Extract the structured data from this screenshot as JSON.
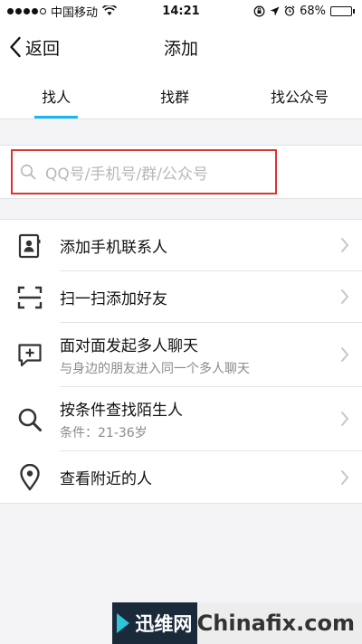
{
  "status_bar": {
    "carrier": "中国移动",
    "time": "14:21",
    "battery": "68%",
    "battery_level": 0.68
  },
  "nav": {
    "back_label": "返回",
    "title": "添加"
  },
  "tabs": [
    {
      "label": "找人",
      "active": true
    },
    {
      "label": "找群",
      "active": false
    },
    {
      "label": "找公众号",
      "active": false
    }
  ],
  "search": {
    "placeholder": "QQ号/手机号/群/公众号"
  },
  "list": {
    "items": [
      {
        "label": "添加手机联系人",
        "icon": "contact-card-icon"
      },
      {
        "label": "扫一扫添加好友",
        "icon": "scan-icon"
      },
      {
        "label": "面对面发起多人聊天",
        "sub": "与身边的朋友进入同一个多人聊天",
        "icon": "chat-add-icon"
      },
      {
        "label": "按条件查找陌生人",
        "sub": "条件：21-36岁",
        "icon": "search-icon"
      },
      {
        "label": "查看附近的人",
        "icon": "location-pin-icon"
      }
    ]
  },
  "watermark": {
    "brand": "迅维网",
    "site": "Chinafix.com"
  },
  "colors": {
    "accent": "#12b7f5",
    "highlight_border": "#dd3333",
    "icon": "#333333"
  }
}
